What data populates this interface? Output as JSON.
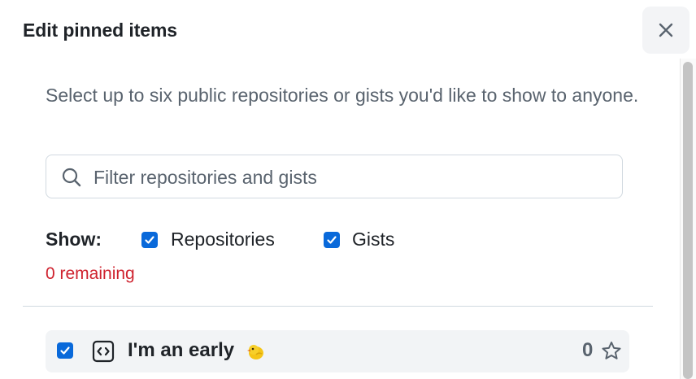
{
  "dialog": {
    "title": "Edit pinned items",
    "close_icon": "x-icon",
    "description": "Select up to six public repositories or gists you'd like to show to anyone."
  },
  "filter": {
    "placeholder": "Filter repositories and gists",
    "value": "",
    "icon": "search-icon"
  },
  "show": {
    "label": "Show:",
    "options": [
      {
        "label": "Repositories",
        "checked": true
      },
      {
        "label": "Gists",
        "checked": true
      }
    ]
  },
  "remaining": "0 remaining",
  "items": [
    {
      "name": "I'm an early",
      "emoji": "🐤",
      "emoji_icon": "baby-chick-icon",
      "type_icon": "code-square-icon",
      "checked": true,
      "stars": "0",
      "star_icon": "star-icon"
    }
  ],
  "colors": {
    "accent": "#0969da",
    "danger": "#cf222e",
    "muted_text": "#59636e",
    "item_bg": "#f2f4f6"
  }
}
